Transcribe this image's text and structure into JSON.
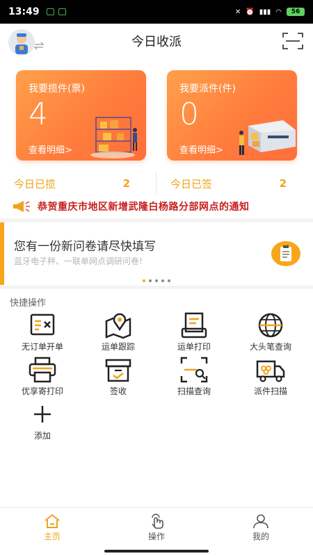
{
  "status_bar": {
    "time": "13:49",
    "battery": "56"
  },
  "header": {
    "title": "今日收派"
  },
  "cards": [
    {
      "title": "我要揽件(票)",
      "value": "4",
      "link": "查看明细>"
    },
    {
      "title": "我要派件(件)",
      "value": "0",
      "link": "查看明细>"
    }
  ],
  "stats": [
    {
      "label": "今日已揽",
      "value": "2"
    },
    {
      "label": "今日已签",
      "value": "2"
    }
  ],
  "notice": {
    "text": "恭贺重庆市地区新增武隆白杨路分部网点的通知"
  },
  "survey": {
    "title": "您有一份新问卷请尽快填写",
    "subtitle": "蓝牙电子秤、一联单网点调研问卷!"
  },
  "quick_actions": {
    "title": "快捷操作",
    "items": [
      {
        "label": "无订单开单",
        "icon": "cancel-order-icon"
      },
      {
        "label": "运单跟踪",
        "icon": "map-pin-icon"
      },
      {
        "label": "运单打印",
        "icon": "print-icon"
      },
      {
        "label": "大头笔查询",
        "icon": "globe-icon"
      },
      {
        "label": "优享寄打印",
        "icon": "printer-icon"
      },
      {
        "label": "签收",
        "icon": "box-check-icon"
      },
      {
        "label": "扫描查询",
        "icon": "scan-search-icon"
      },
      {
        "label": "派件扫描",
        "icon": "delivery-truck-icon"
      },
      {
        "label": "添加",
        "icon": "plus-icon"
      }
    ]
  },
  "bottom_nav": [
    {
      "label": "主页",
      "icon": "home-icon",
      "active": true
    },
    {
      "label": "操作",
      "icon": "hand-tap-icon",
      "active": false
    },
    {
      "label": "我的",
      "icon": "user-icon",
      "active": false
    }
  ],
  "colors": {
    "accent": "#f0a31a",
    "card_gradient_start": "#ffa04a",
    "card_gradient_end": "#ff6e3a",
    "notice_red": "#c8201e"
  }
}
